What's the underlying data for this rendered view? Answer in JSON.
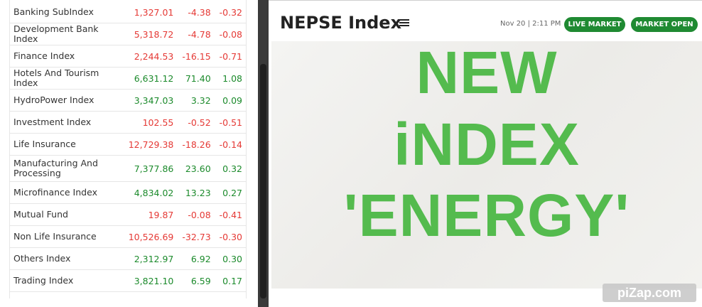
{
  "indices": [
    {
      "name": "Banking SubIndex",
      "value": "1,327.01",
      "change": "-4.38",
      "pct": "-0.32",
      "trend": "neg"
    },
    {
      "name": "Development Bank Index",
      "value": "5,318.72",
      "change": "-4.78",
      "pct": "-0.08",
      "trend": "neg"
    },
    {
      "name": "Finance Index",
      "value": "2,244.53",
      "change": "-16.15",
      "pct": "-0.71",
      "trend": "neg"
    },
    {
      "name": "Hotels And Tourism Index",
      "value": "6,631.12",
      "change": "71.40",
      "pct": "1.08",
      "trend": "pos"
    },
    {
      "name": "HydroPower Index",
      "value": "3,347.03",
      "change": "3.32",
      "pct": "0.09",
      "trend": "pos"
    },
    {
      "name": "Investment Index",
      "value": "102.55",
      "change": "-0.52",
      "pct": "-0.51",
      "trend": "neg"
    },
    {
      "name": "Life Insurance",
      "value": "12,729.38",
      "change": "-18.26",
      "pct": "-0.14",
      "trend": "neg"
    },
    {
      "name": "Manufacturing And Processing",
      "value": "7,377.86",
      "change": "23.60",
      "pct": "0.32",
      "trend": "pos"
    },
    {
      "name": "Microfinance Index",
      "value": "4,834.02",
      "change": "13.23",
      "pct": "0.27",
      "trend": "pos"
    },
    {
      "name": "Mutual Fund",
      "value": "19.87",
      "change": "-0.08",
      "pct": "-0.41",
      "trend": "neg"
    },
    {
      "name": "Non Life Insurance",
      "value": "10,526.69",
      "change": "-32.73",
      "pct": "-0.30",
      "trend": "neg"
    },
    {
      "name": "Others Index",
      "value": "2,312.97",
      "change": "6.92",
      "pct": "0.30",
      "trend": "pos"
    },
    {
      "name": "Trading Index",
      "value": "3,821.10",
      "change": "6.59",
      "pct": "0.17",
      "trend": "pos"
    }
  ],
  "header": {
    "title": "NEPSE Index",
    "timestamp": "Nov 20 | 2:11 PM",
    "live_badge": "LIVE MARKET",
    "status_badge": "MARKET OPEN"
  },
  "banner": {
    "line1": "NEW",
    "line2": "iNDEX",
    "line3": "'ENERGY'"
  },
  "watermark": "piZap.com",
  "colors": {
    "negative": "#e53935",
    "positive": "#1b8a2b",
    "badge": "#1f8a32",
    "banner_text": "#54bb4e"
  }
}
